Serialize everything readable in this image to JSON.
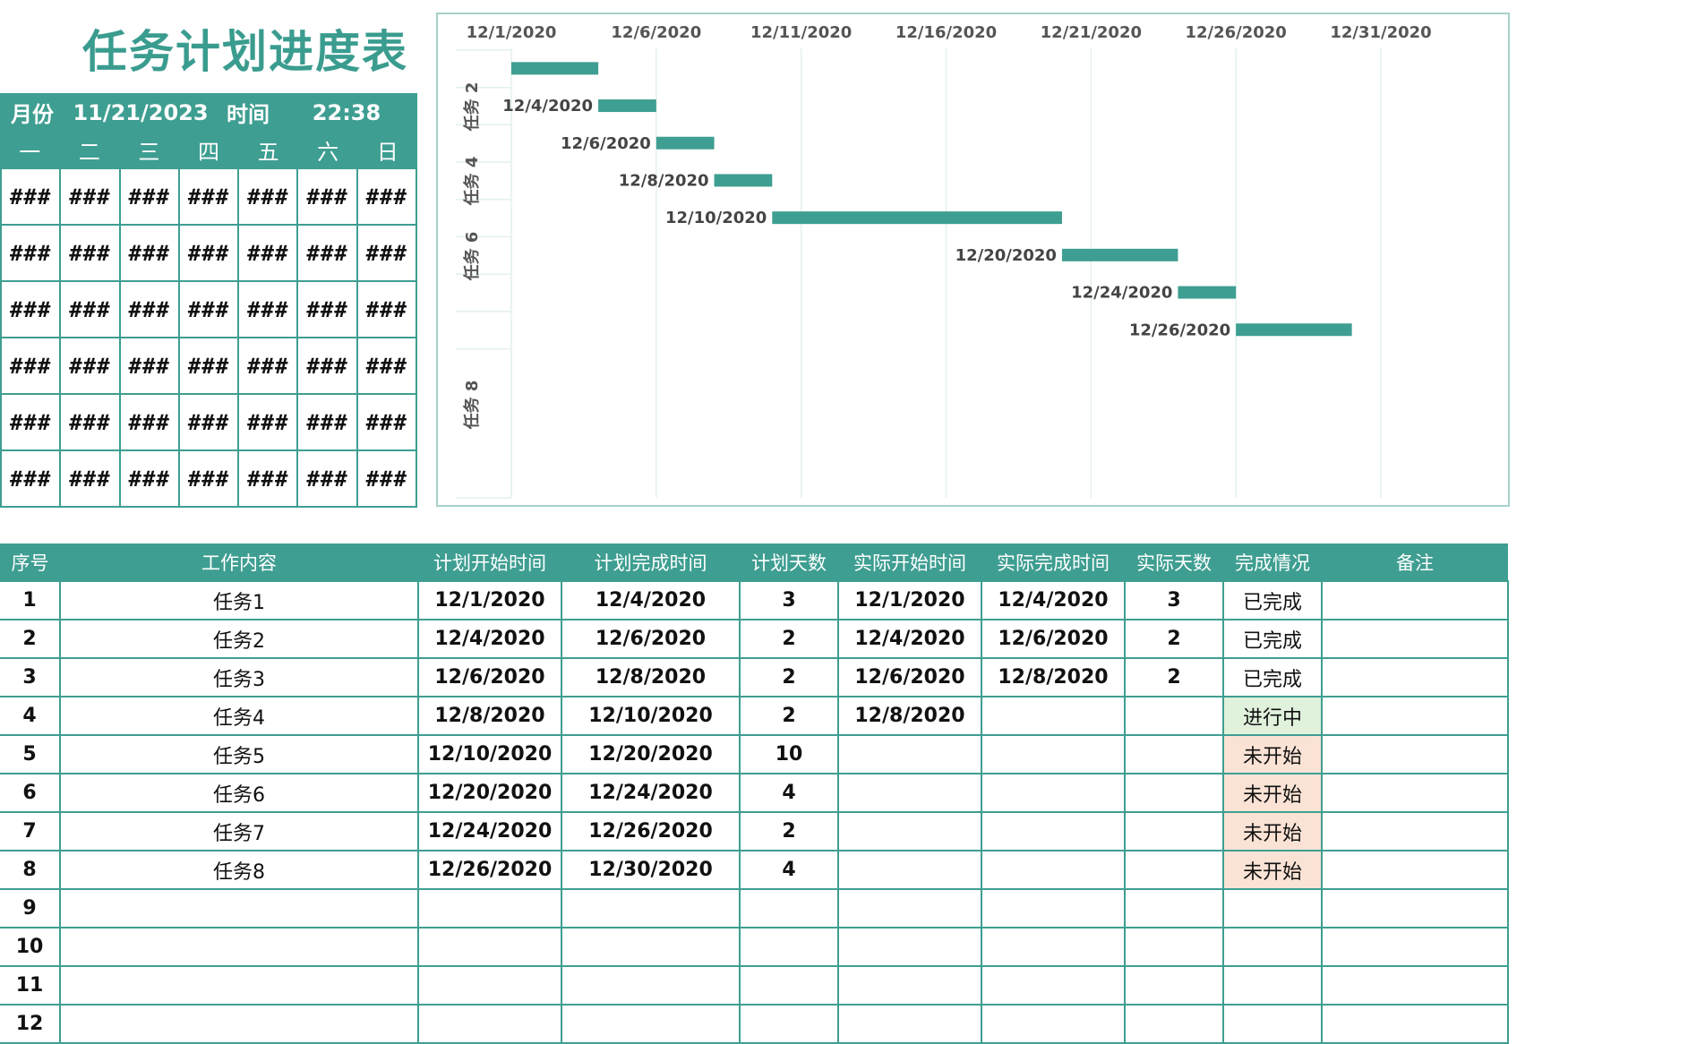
{
  "title": "任务计划进度表",
  "calendar": {
    "month_label": "月份",
    "date_value": "11/21/2023",
    "time_label": "时间",
    "time_value": "22:38",
    "weekdays": [
      "一",
      "二",
      "三",
      "四",
      "五",
      "六",
      "日"
    ],
    "cell_text": "###",
    "rows": 6
  },
  "chart_data": {
    "type": "bar",
    "subtype": "gantt",
    "x_ticks": [
      "12/1/2020",
      "12/6/2020",
      "12/11/2020",
      "12/16/2020",
      "12/21/2020",
      "12/26/2020",
      "12/31/2020"
    ],
    "xlim": [
      "2020-12-01",
      "2020-12-31"
    ],
    "y_tick_labels": [
      "任务 2",
      "任务 4",
      "任务 6",
      "任务 8"
    ],
    "bar_color": "#3e9e91",
    "tasks": [
      {
        "name": "任务1",
        "start": "2020-12-01",
        "duration": 3,
        "label": ""
      },
      {
        "name": "任务2",
        "start": "2020-12-04",
        "duration": 2,
        "label": "12/4/2020"
      },
      {
        "name": "任务3",
        "start": "2020-12-06",
        "duration": 2,
        "label": "12/6/2020"
      },
      {
        "name": "任务4",
        "start": "2020-12-08",
        "duration": 2,
        "label": "12/8/2020"
      },
      {
        "name": "任务5",
        "start": "2020-12-10",
        "duration": 10,
        "label": "12/10/2020"
      },
      {
        "name": "任务6",
        "start": "2020-12-20",
        "duration": 4,
        "label": "12/20/2020"
      },
      {
        "name": "任务7",
        "start": "2020-12-24",
        "duration": 2,
        "label": "12/24/2020"
      },
      {
        "name": "任务8",
        "start": "2020-12-26",
        "duration": 4,
        "label": "12/26/2020"
      }
    ]
  },
  "table": {
    "headers": [
      "序号",
      "工作内容",
      "计划开始时间",
      "计划完成时间",
      "计划天数",
      "实际开始时间",
      "实际完成时间",
      "实际天数",
      "完成情况",
      "备注"
    ],
    "rows": [
      {
        "no": "1",
        "task": "任务1",
        "plan_start": "12/1/2020",
        "plan_end": "12/4/2020",
        "plan_days": "3",
        "act_start": "12/1/2020",
        "act_end": "12/4/2020",
        "act_days": "3",
        "status": "已完成",
        "status_kind": "done",
        "note": ""
      },
      {
        "no": "2",
        "task": "任务2",
        "plan_start": "12/4/2020",
        "plan_end": "12/6/2020",
        "plan_days": "2",
        "act_start": "12/4/2020",
        "act_end": "12/6/2020",
        "act_days": "2",
        "status": "已完成",
        "status_kind": "done",
        "note": ""
      },
      {
        "no": "3",
        "task": "任务3",
        "plan_start": "12/6/2020",
        "plan_end": "12/8/2020",
        "plan_days": "2",
        "act_start": "12/6/2020",
        "act_end": "12/8/2020",
        "act_days": "2",
        "status": "已完成",
        "status_kind": "done",
        "note": ""
      },
      {
        "no": "4",
        "task": "任务4",
        "plan_start": "12/8/2020",
        "plan_end": "12/10/2020",
        "plan_days": "2",
        "act_start": "12/8/2020",
        "act_end": "",
        "act_days": "",
        "status": "进行中",
        "status_kind": "prog",
        "note": ""
      },
      {
        "no": "5",
        "task": "任务5",
        "plan_start": "12/10/2020",
        "plan_end": "12/20/2020",
        "plan_days": "10",
        "act_start": "",
        "act_end": "",
        "act_days": "",
        "status": "未开始",
        "status_kind": "todo",
        "note": ""
      },
      {
        "no": "6",
        "task": "任务6",
        "plan_start": "12/20/2020",
        "plan_end": "12/24/2020",
        "plan_days": "4",
        "act_start": "",
        "act_end": "",
        "act_days": "",
        "status": "未开始",
        "status_kind": "todo",
        "note": ""
      },
      {
        "no": "7",
        "task": "任务7",
        "plan_start": "12/24/2020",
        "plan_end": "12/26/2020",
        "plan_days": "2",
        "act_start": "",
        "act_end": "",
        "act_days": "",
        "status": "未开始",
        "status_kind": "todo",
        "note": ""
      },
      {
        "no": "8",
        "task": "任务8",
        "plan_start": "12/26/2020",
        "plan_end": "12/30/2020",
        "plan_days": "4",
        "act_start": "",
        "act_end": "",
        "act_days": "",
        "status": "未开始",
        "status_kind": "todo",
        "note": ""
      },
      {
        "no": "9",
        "task": "",
        "plan_start": "",
        "plan_end": "",
        "plan_days": "",
        "act_start": "",
        "act_end": "",
        "act_days": "",
        "status": "",
        "status_kind": "",
        "note": ""
      },
      {
        "no": "10",
        "task": "",
        "plan_start": "",
        "plan_end": "",
        "plan_days": "",
        "act_start": "",
        "act_end": "",
        "act_days": "",
        "status": "",
        "status_kind": "",
        "note": ""
      },
      {
        "no": "11",
        "task": "",
        "plan_start": "",
        "plan_end": "",
        "plan_days": "",
        "act_start": "",
        "act_end": "",
        "act_days": "",
        "status": "",
        "status_kind": "",
        "note": ""
      },
      {
        "no": "12",
        "task": "",
        "plan_start": "",
        "plan_end": "",
        "plan_days": "",
        "act_start": "",
        "act_end": "",
        "act_days": "",
        "status": "",
        "status_kind": "",
        "note": ""
      }
    ]
  }
}
